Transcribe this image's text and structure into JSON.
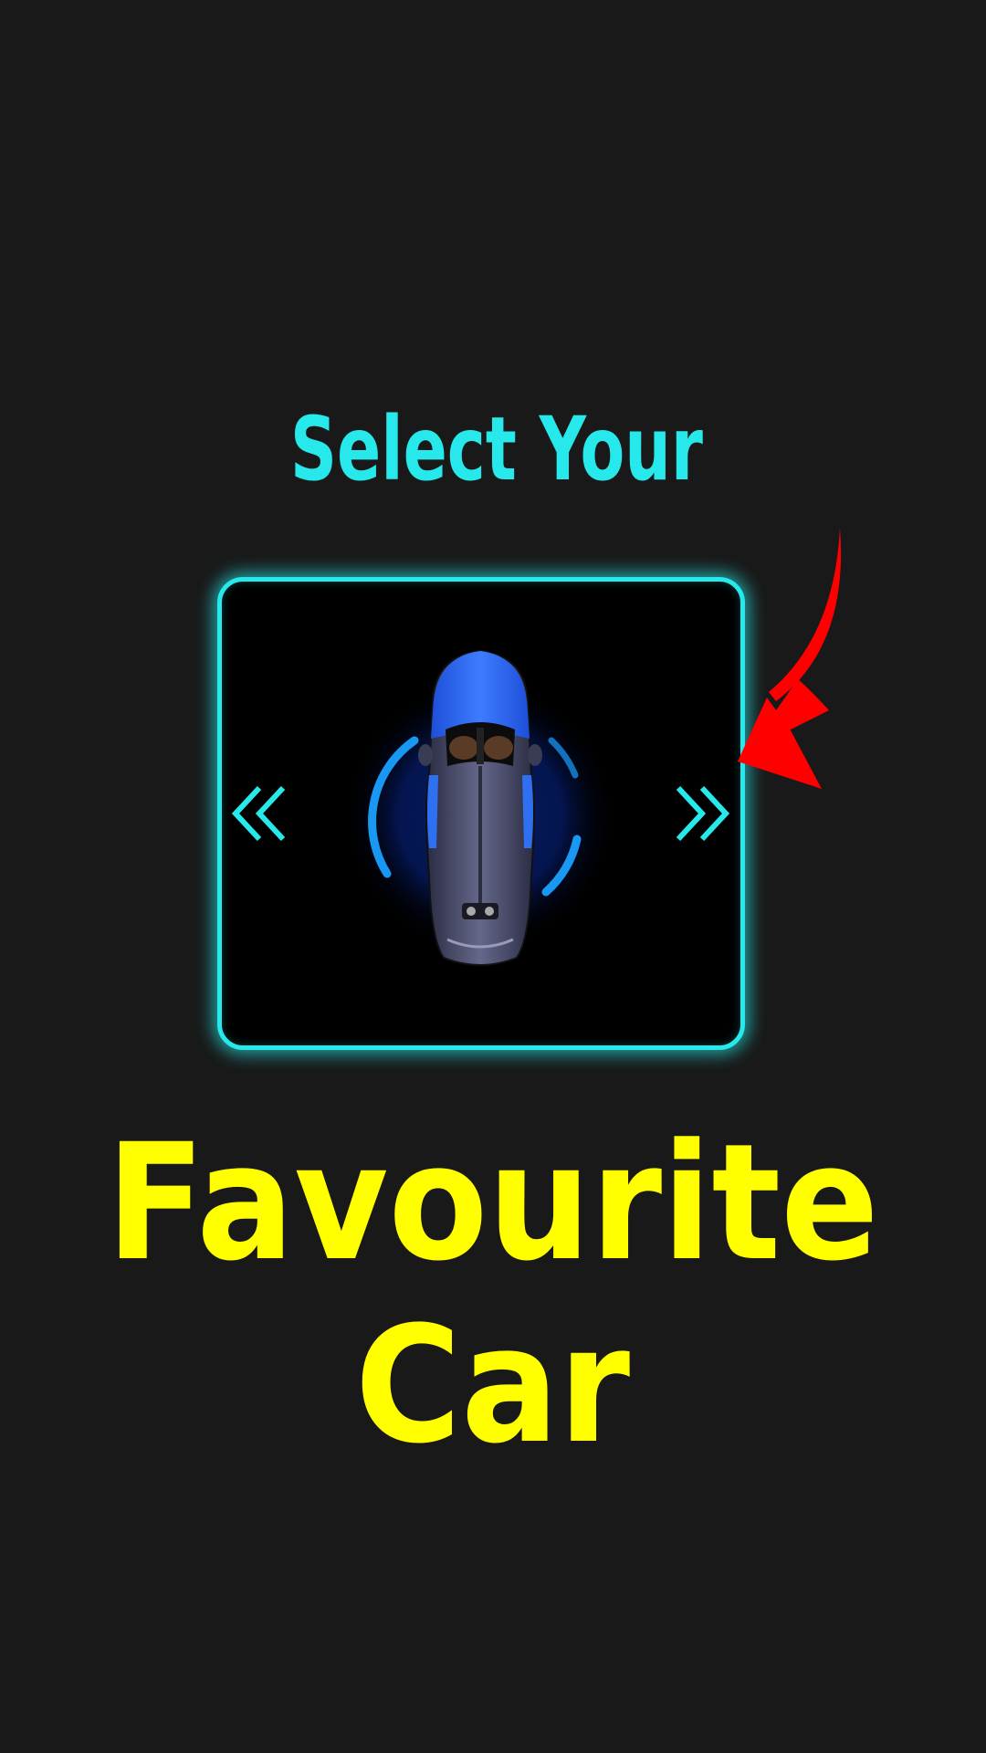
{
  "heading": {
    "line1": "Select Your",
    "line2": "Favourite Car",
    "line1_color": "#27e8ea",
    "line2_color": "#ffff00"
  },
  "selector": {
    "border_color": "#27e8ea",
    "prev_icon": "double-chevron-left-icon",
    "next_icon": "double-chevron-right-icon",
    "car_icon": "sports-car-top-view",
    "car_body_color": "#2f6ff2",
    "hint_arrow_color": "#ff0000"
  }
}
